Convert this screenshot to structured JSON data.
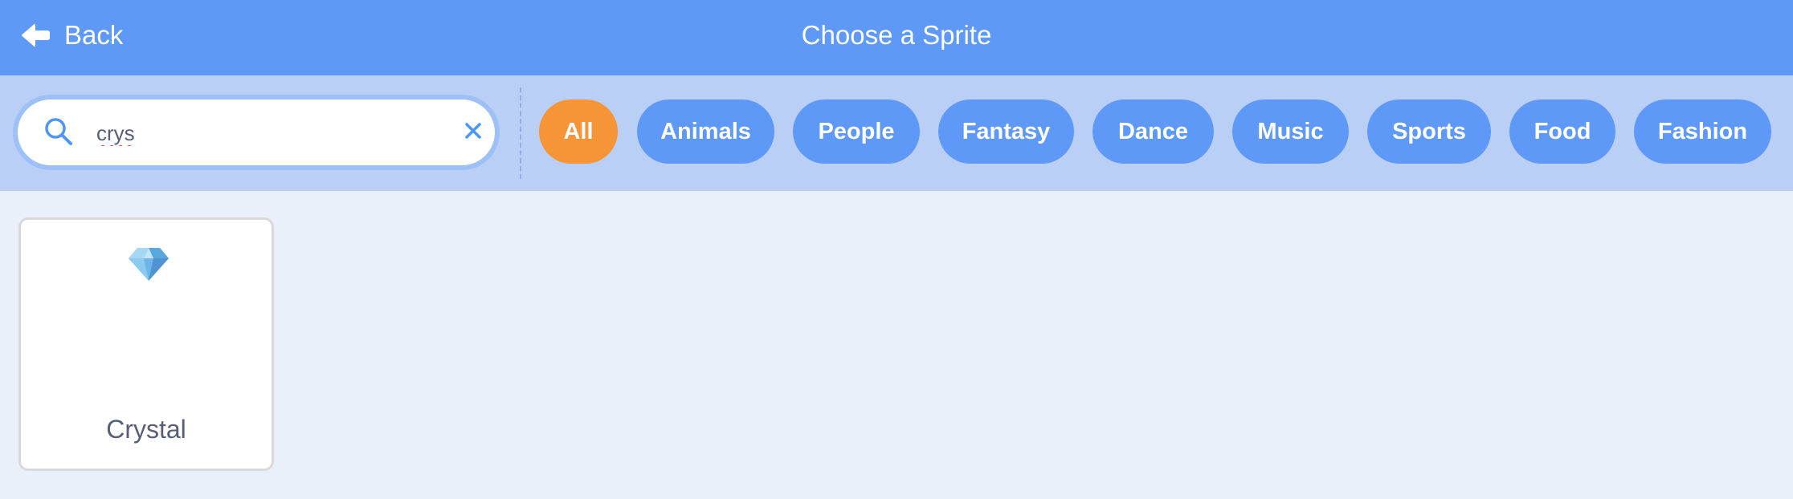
{
  "header": {
    "back_label": "Back",
    "title": "Choose a Sprite"
  },
  "search": {
    "value": "crys",
    "icons": {
      "search": "search-icon",
      "clear": "close-icon"
    }
  },
  "tags": [
    {
      "label": "All",
      "active": true
    },
    {
      "label": "Animals",
      "active": false
    },
    {
      "label": "People",
      "active": false
    },
    {
      "label": "Fantasy",
      "active": false
    },
    {
      "label": "Dance",
      "active": false
    },
    {
      "label": "Music",
      "active": false
    },
    {
      "label": "Sports",
      "active": false
    },
    {
      "label": "Food",
      "active": false
    },
    {
      "label": "Fashion",
      "active": false
    }
  ],
  "results": [
    {
      "name": "Crystal",
      "icon": "crystal-gem-icon"
    }
  ],
  "colors": {
    "header": "#5e99f8",
    "filter_bar": "#b9cff6",
    "tag": "#5e99f8",
    "active_tag": "#f69438",
    "background": "#e9f0fa"
  }
}
